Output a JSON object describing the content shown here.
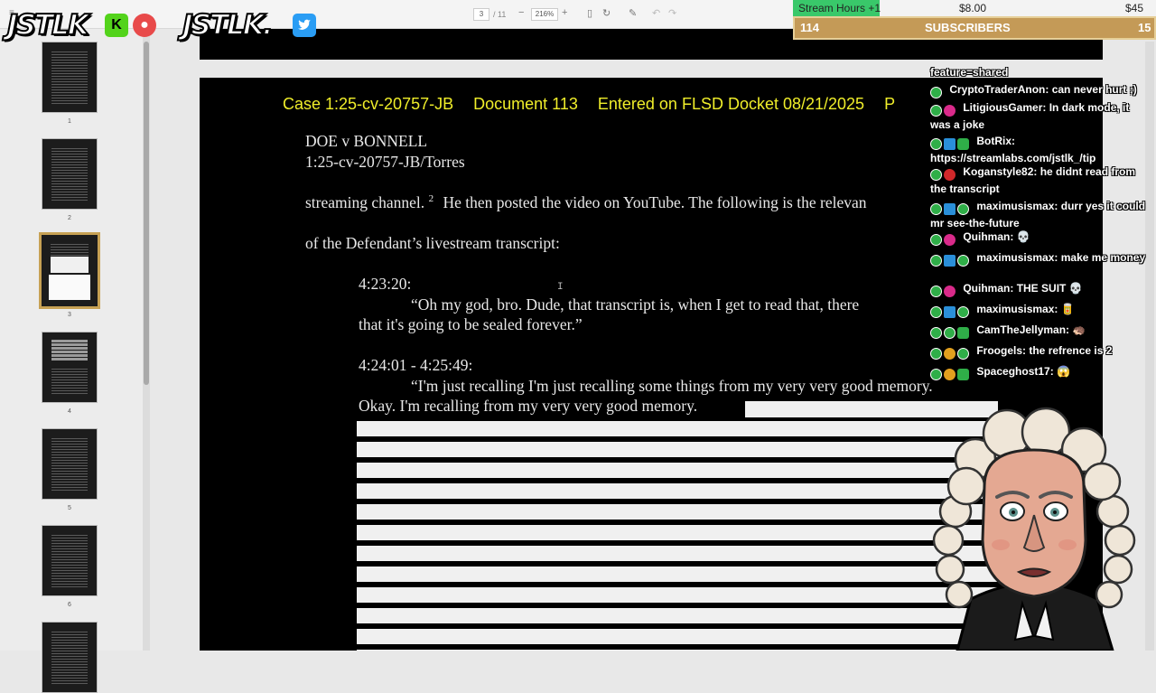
{
  "viewer": {
    "page_current": "3",
    "page_total": "/ 11",
    "zoom": "216%",
    "zoom_out_label": "−",
    "zoom_in_label": "+"
  },
  "sidebar": {
    "thumbnails": [
      {
        "label": "1"
      },
      {
        "label": "2"
      },
      {
        "label": "3"
      },
      {
        "label": "4"
      },
      {
        "label": "5"
      },
      {
        "label": "6"
      }
    ]
  },
  "document": {
    "header": {
      "case": "Case 1:25-cv-20757-JB",
      "doc": "Document 113",
      "entered": "Entered on FLSD Docket 08/21/2025",
      "page": "P"
    },
    "caption_line1": "DOE v BONNELL",
    "caption_line2": "1:25-cv-20757-JB/Torres",
    "para1": "streaming channel.",
    "footnote": "2",
    "para1_rest": "He then posted the video on YouTube. The following is the relevan",
    "para2": "of the Defendant’s livestream transcript:",
    "ts1": "4:23:20:",
    "quote1_a": "“Oh my god, bro. Dude, that transcript is, when I get to read that, there",
    "quote1_b": "that it's going to be sealed forever.”",
    "ts2": "4:24:01 - 4:25:49:",
    "quote2_a": "“I'm just recalling I'm just recalling some things from my very very good memory.",
    "quote2_b": "Okay. I'm recalling from my very very good memory."
  },
  "overlay": {
    "logo1": "JSTLK",
    "logo1_badge": "K",
    "logo2": "JSTLK.",
    "stream_hours_label": "Stream Hours +1",
    "amount_1": "$8.00",
    "amount_2": "$45",
    "sub_count_left": "114",
    "subscribers_label": "SUBSCRIBERS",
    "sub_count_right": "15",
    "colors": {
      "accent_green": "#39c86a",
      "gold": "#c49a57",
      "header_yellow": "#f0ee2a"
    }
  },
  "chat": [
    {
      "user": "",
      "msg": "feature=shared"
    },
    {
      "user": "CryptoTraderAnon:",
      "msg": "can never hurt ;)"
    },
    {
      "user": "LitigiousGamer:",
      "msg": "In dark mode, it was a joke"
    },
    {
      "user": "BotRix:",
      "msg": "https://streamlabs.com/jstlk_/tip"
    },
    {
      "user": "Koganstyle82:",
      "msg": "he didnt read from the transcript"
    },
    {
      "user": "maximusismax:",
      "msg": "durr yes it could mr see-the-future"
    },
    {
      "user": "Quihman:",
      "msg": "💀"
    },
    {
      "user": "maximusismax:",
      "msg": "make me money"
    },
    {
      "user": "Quihman:",
      "msg": "THE SUIT 💀"
    },
    {
      "user": "maximusismax:",
      "msg": "🥫"
    },
    {
      "user": "CamTheJellyman:",
      "msg": "🦔"
    },
    {
      "user": "Froogels:",
      "msg": "the refrence is 2"
    },
    {
      "user": "Spaceghost17:",
      "msg": "😱"
    }
  ]
}
